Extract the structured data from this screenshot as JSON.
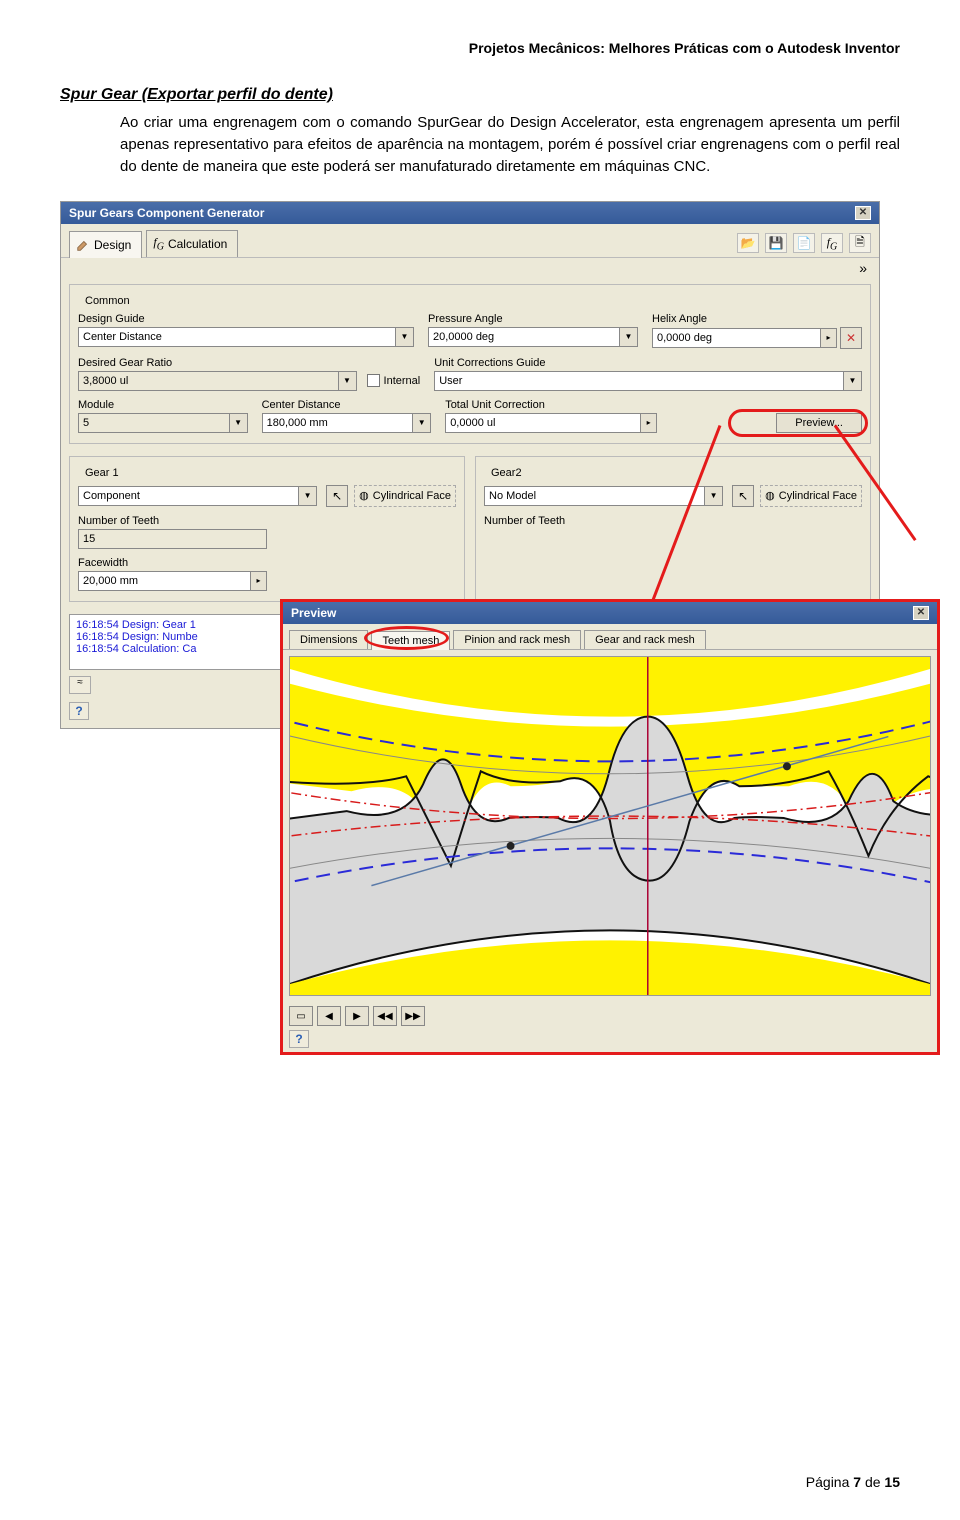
{
  "doc": {
    "header": "Projetos Mecânicos: Melhores Práticas com o Autodesk Inventor",
    "section_title": "Spur Gear (Exportar perfil do dente)",
    "paragraph": "Ao criar uma engrenagem com o comando SpurGear do Design Accelerator, esta engrenagem apresenta um perfil apenas representativo para efeitos de aparência na montagem, porém é possível criar engrenagens com o perfil real do dente de maneira que este poderá ser manufaturado diretamente em máquinas CNC.",
    "footer_prefix": "Página ",
    "footer_page": "7",
    "footer_mid": " de ",
    "footer_total": "15"
  },
  "generator": {
    "title": "Spur Gears Component Generator",
    "tabs": {
      "design": "Design",
      "calculation": "Calculation"
    },
    "common": {
      "legend": "Common",
      "design_guide_lbl": "Design Guide",
      "design_guide_val": "Center Distance",
      "gear_ratio_lbl": "Desired Gear Ratio",
      "gear_ratio_val": "3,8000 ul",
      "internal_lbl": "Internal",
      "module_lbl": "Module",
      "module_val": "5",
      "center_dist_lbl": "Center Distance",
      "center_dist_val": "180,000 mm",
      "pressure_lbl": "Pressure Angle",
      "pressure_val": "20,0000 deg",
      "helix_lbl": "Helix Angle",
      "helix_val": "0,0000 deg",
      "ucg_lbl": "Unit Corrections Guide",
      "ucg_val": "User",
      "tuc_lbl": "Total Unit Correction",
      "tuc_val": "0,0000 ul",
      "preview_btn": "Preview..."
    },
    "gear1": {
      "legend": "Gear 1",
      "type_val": "Component",
      "cyl_label": "Cylindrical Face",
      "teeth_lbl": "Number of Teeth",
      "teeth_val": "15",
      "facewidth_lbl": "Facewidth",
      "facewidth_val": "20,000 mm"
    },
    "gear2": {
      "legend": "Gear2",
      "type_val": "No Model",
      "cyl_label": "Cylindrical Face",
      "teeth_lbl_partial": "Number of Teeth"
    },
    "log": {
      "l1": "16:18:54 Design: Gear 1",
      "l2": "16:18:54 Design: Numbe",
      "l3": "16:18:54 Calculation: Ca"
    }
  },
  "preview": {
    "title": "Preview",
    "tabs": {
      "dimensions": "Dimensions",
      "teeth": "Teeth mesh",
      "pinion": "Pinion and rack mesh",
      "gear": "Gear and rack mesh"
    }
  }
}
